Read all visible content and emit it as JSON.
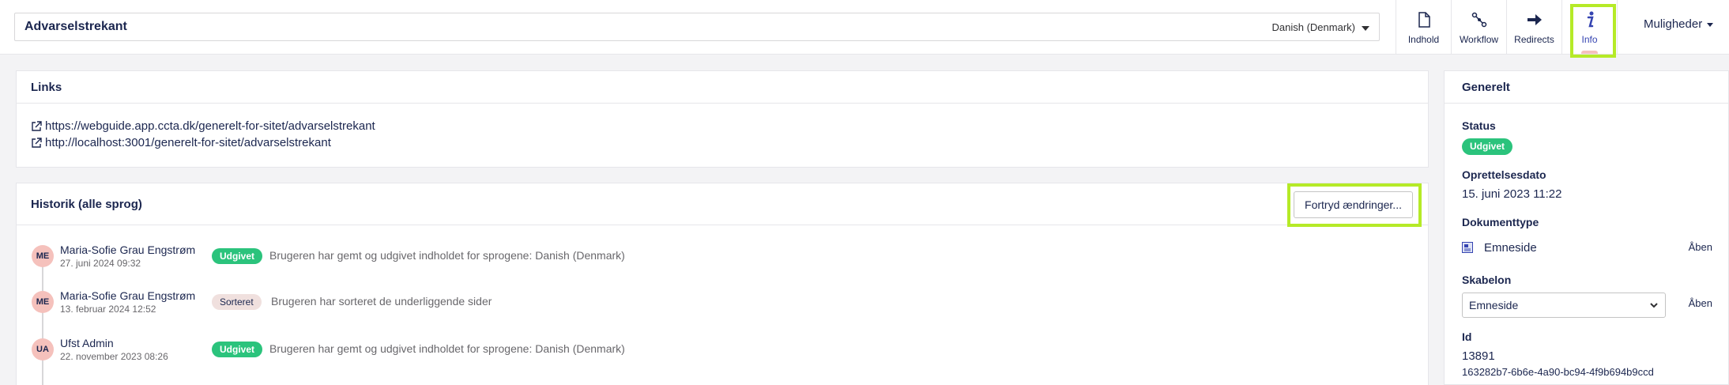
{
  "header": {
    "document_name": "Advarselstrekant",
    "language": "Danish (Denmark)",
    "apps": [
      {
        "label": "Indhold",
        "icon": "document-icon"
      },
      {
        "label": "Workflow",
        "icon": "workflow-icon"
      },
      {
        "label": "Redirects",
        "icon": "arrow-right-icon"
      },
      {
        "label": "Info",
        "icon": "info-icon"
      }
    ],
    "more_label": "Muligheder"
  },
  "links": {
    "title": "Links",
    "items": [
      "https://webguide.app.ccta.dk/generelt-for-sitet/advarselstrekant",
      "http://localhost:3001/generelt-for-sitet/advarselstrekant"
    ]
  },
  "history": {
    "title": "Historik (alle sprog)",
    "undo_label": "Fortryd ændringer...",
    "entries": [
      {
        "initials": "ME",
        "user": "Maria-Sofie Grau Engstrøm",
        "date": "27. juni 2024 09:32",
        "badge": "Udgivet",
        "text": "Brugeren har gemt og udgivet indholdet for sprogene: Danish (Denmark)"
      },
      {
        "initials": "ME",
        "user": "Maria-Sofie Grau Engstrøm",
        "date": "13. februar 2024 12:52",
        "badge": "Sorteret",
        "text": "Brugeren har sorteret de underliggende sider"
      },
      {
        "initials": "UA",
        "user": "Ufst Admin",
        "date": "22. november 2023 08:26",
        "badge": "Udgivet",
        "text": "Brugeren har gemt og udgivet indholdet for sprogene: Danish (Denmark)"
      }
    ]
  },
  "general": {
    "title": "Generelt",
    "status_label": "Status",
    "status_value": "Udgivet",
    "created_label": "Oprettelsesdato",
    "created_value": "15. juni 2023 11:22",
    "doctype_label": "Dokumenttype",
    "doctype_value": "Emneside",
    "open_label": "Åben",
    "template_label": "Skabelon",
    "template_value": "Emneside",
    "id_label": "Id",
    "id_value": "13891",
    "guid_value": "163282b7-6b6e-4a90-bc94-4f9b694b9ccd"
  },
  "colors": {
    "accent_highlight": "#b5ea27",
    "published_badge": "#2bc37c",
    "avatar": "#f5c1bc",
    "text_primary": "#1b264f"
  }
}
